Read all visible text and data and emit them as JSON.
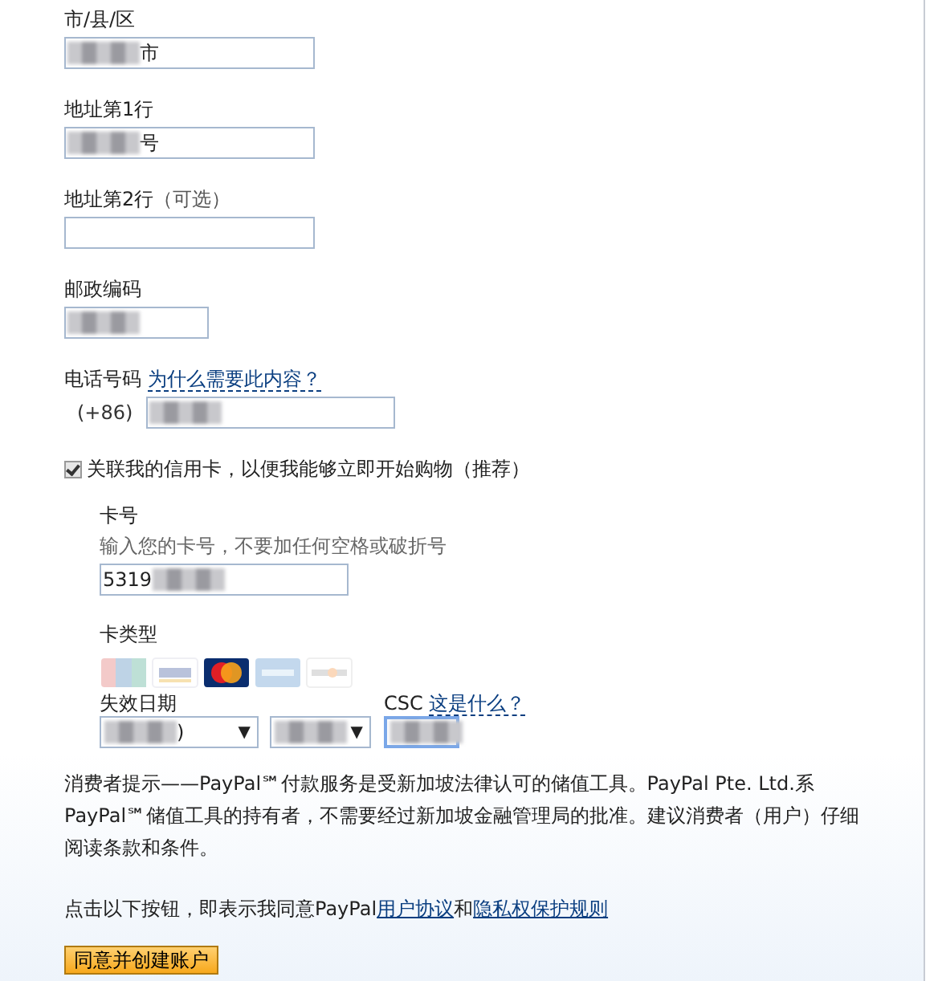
{
  "address_fields": [
    {
      "kind": "address",
      "label": "市/县/区",
      "value": "市",
      "blurred": true
    },
    {
      "kind": "address",
      "label": "地址第1行",
      "value": "号",
      "blurred": true
    },
    {
      "kind": "optional",
      "label": "地址第2行",
      "note": "（可选）"
    },
    {
      "kind": "postal",
      "label": "邮政编码",
      "blurred": true
    },
    {
      "kind": "phone",
      "label": "电话号码",
      "help_link": "为什么需要此内容？",
      "prefix": "(+86)",
      "blurred": true
    }
  ],
  "link_card": {
    "label": "关联我的信用卡，以便我能够立即开始购物（推荐）",
    "checked": true
  },
  "card_number": {
    "label": "卡号",
    "hint": "输入您的卡号，不要加任何空格或破折号",
    "value": "5319",
    "blurred": true
  },
  "card_type": {
    "label": "卡类型",
    "cards": [
      {
        "kind": "unionpay",
        "selected": false
      },
      {
        "kind": "visa",
        "selected": false
      },
      {
        "kind": "mastercard",
        "selected": true
      },
      {
        "kind": "amex",
        "selected": false
      },
      {
        "kind": "discover",
        "selected": false
      }
    ]
  },
  "expiry": {
    "label": "失效日期",
    "month": {
      "value": ")",
      "blurred": true,
      "caret": "▼"
    },
    "year": {
      "blurred": true,
      "caret": "▼"
    }
  },
  "csc": {
    "label": "CSC",
    "help_link": "这是什么？",
    "blurred": true,
    "focused": true
  },
  "notice": "消费者提示——PayPal℠付款服务是受新加坡法律认可的储值工具。PayPal Pte. Ltd.系PayPal℠储值工具的持有者，不需要经过新加坡金融管理局的批准。建议消费者（用户）仔细阅读条款和条件。",
  "agreement": {
    "text": "点击以下按钮，即表示我同意PayPal",
    "link_1": "用户协议",
    "joiner": "和",
    "link_2": "隐私权保护规则"
  },
  "submit_button": "同意并创建账户"
}
